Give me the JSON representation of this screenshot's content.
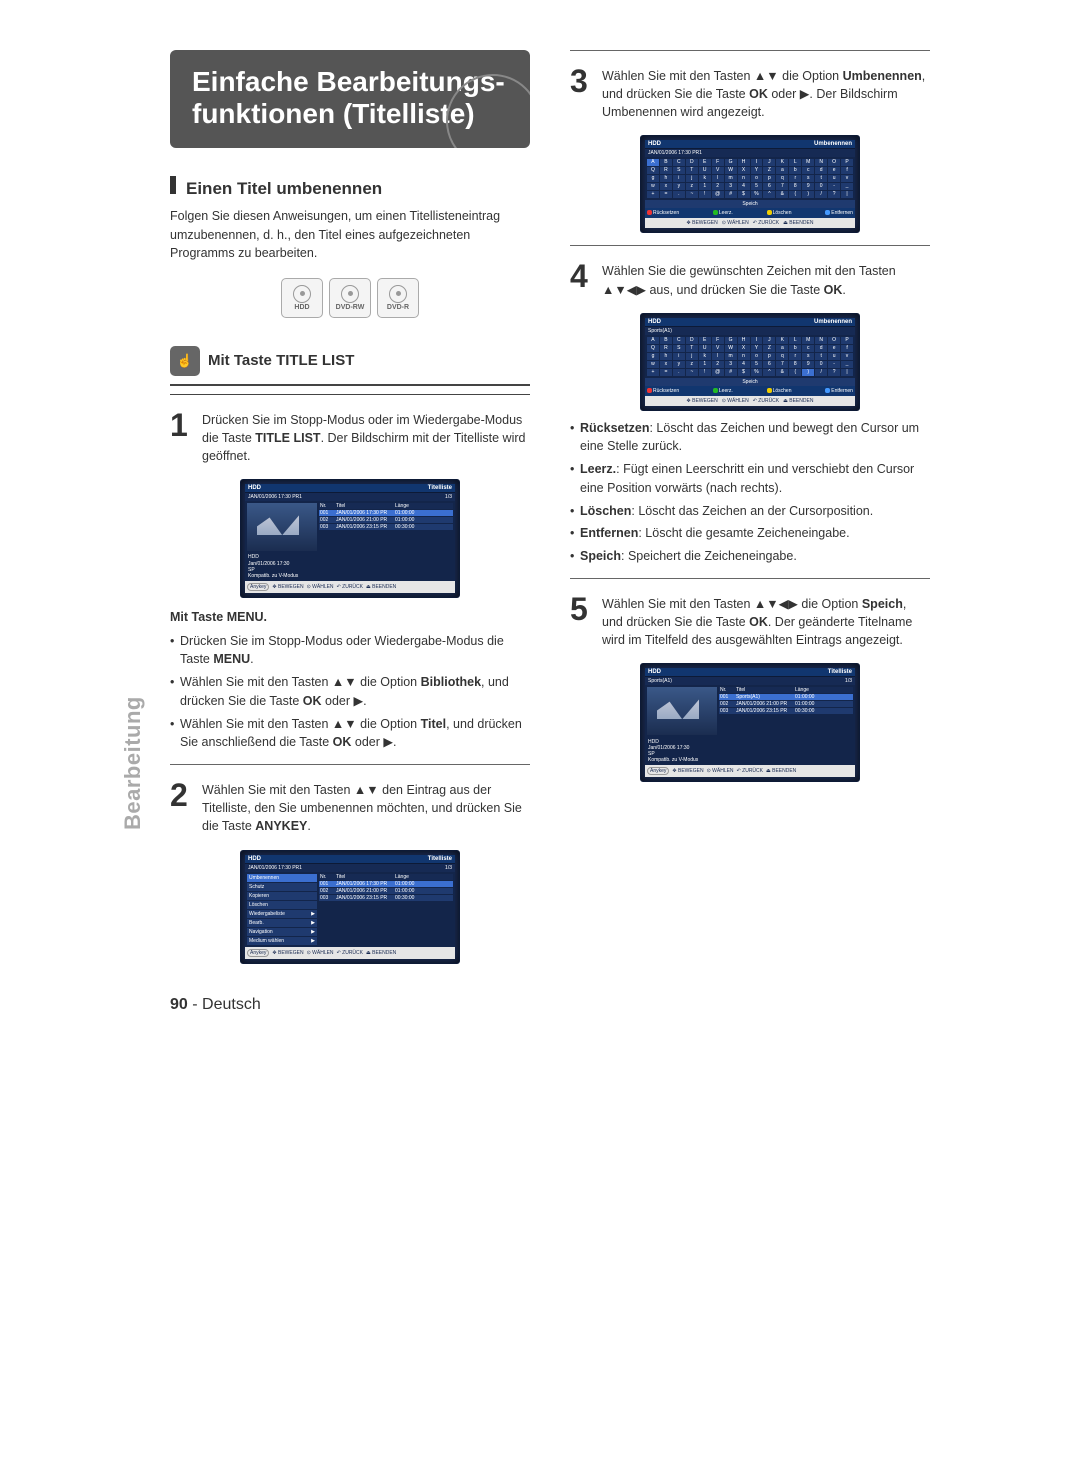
{
  "page": {
    "number": "90",
    "lang": "Deutsch",
    "side_tab": "Bearbeitung"
  },
  "title": "Einfache Bearbeitungs-\nfunktionen (Titelliste)",
  "section_heading": "Einen Titel umbenennen",
  "intro": "Folgen Sie diesen Anweisungen, um einen Titellisteneintrag umzubenennen, d. h., den Titel eines aufgezeichneten Programms zu bearbeiten.",
  "media": [
    "HDD",
    "DVD-RW",
    "DVD-R"
  ],
  "subhead_titlelist": "Mit Taste TITLE LIST",
  "steps": {
    "s1": {
      "num": "1",
      "text": "Drücken Sie im Stopp-Modus oder im Wiedergabe-Modus die Taste ",
      "bold1": "TITLE LIST",
      "text2": ". Der Bildschirm mit der Titelliste wird geöffnet."
    },
    "menu_sub": "Mit Taste MENU.",
    "menu_items": [
      [
        "Drücken Sie im Stopp-Modus oder Wiedergabe-Modus die Taste ",
        "MENU",
        "."
      ],
      [
        "Wählen Sie mit den Tasten ▲▼ die Option ",
        "Bibliothek",
        ", und drücken Sie die Taste ",
        "OK",
        " oder ▶."
      ],
      [
        "Wählen Sie mit den Tasten ▲▼ die Option ",
        "Titel",
        ", und drücken Sie anschließend die Taste ",
        "OK",
        " oder ▶."
      ]
    ],
    "s2": {
      "num": "2",
      "text": "Wählen Sie mit den Tasten ▲▼ den Eintrag aus der Titelliste, den Sie umbenennen möchten, und drücken Sie die Taste ",
      "bold1": "ANYKEY",
      "text2": "."
    },
    "s3": {
      "num": "3",
      "text": "Wählen Sie mit den Tasten ▲▼ die Option ",
      "bold1": "Umbenennen",
      "text2": ", und drücken Sie die Taste ",
      "bold2": "OK",
      "text3": " oder ▶. Der Bildschirm Umbenennen wird angezeigt."
    },
    "s4": {
      "num": "4",
      "text": "Wählen Sie die gewünschten Zeichen mit den Tasten ▲▼◀▶ aus, und drücken Sie die Taste ",
      "bold1": "OK",
      "text2": "."
    },
    "edit_items": [
      [
        "Rücksetzen",
        ": Löscht das Zeichen und bewegt den Cursor um eine Stelle zurück."
      ],
      [
        "Leerz.",
        ": Fügt einen Leerschritt ein und verschiebt den Cursor eine Position vorwärts (nach rechts)."
      ],
      [
        "Löschen",
        ": Löscht das Zeichen an der Cursorposition."
      ],
      [
        "Entfernen",
        ": Löscht die gesamte Zeicheneingabe."
      ],
      [
        "Speich",
        ": Speichert die Zeicheneingabe."
      ]
    ],
    "s5": {
      "num": "5",
      "text": "Wählen Sie mit den Tasten ▲▼◀▶ die Option ",
      "bold1": "Speich",
      "text2": ", und drücken Sie die Taste ",
      "bold2": "OK",
      "text3": ". Der geänderte Titelname wird im Titelfeld des ausgewählten Eintrags angezeigt."
    }
  },
  "tv_common": {
    "hdd": "HDD",
    "footer": {
      "move": "BEWEGEN",
      "sel": "WÄHLEN",
      "back": "ZURÜCK",
      "exit": "BEENDEN"
    },
    "btns": {
      "reset": "Rücksetzen",
      "space": "Leerz.",
      "del": "Löschen",
      "rem": "Entfernen"
    },
    "save": "Speich",
    "anykey": "Anykey"
  },
  "tv1": {
    "title": "Titelliste",
    "sub": "JAN/01/2006 17:30 PR1",
    "page": "1/3",
    "cols": [
      "Nr.",
      "Titel",
      "Länge"
    ],
    "rows": [
      [
        "001",
        "JAN/01/2006 17:30 PR",
        "01:00:00"
      ],
      [
        "002",
        "JAN/01/2006 21:00 PR",
        "01:00:00"
      ],
      [
        "003",
        "JAN/01/2006 23:15 PR",
        "00:30:00"
      ]
    ],
    "meta": [
      "HDD",
      "Jan/01/2006 17:30",
      "SP",
      "Kompatib. zu V-Modus"
    ]
  },
  "tv2": {
    "title": "Titelliste",
    "sub": "JAN/01/2006 17:30 PR1",
    "page": "1/3",
    "cols": [
      "Nr.",
      "Titel",
      "Länge"
    ],
    "rows": [
      [
        "001",
        "JAN/01/2006 17:30 PR",
        "01:00:00"
      ],
      [
        "002",
        "JAN/01/2006 21:00 PR",
        "01:00:00"
      ],
      [
        "003",
        "JAN/01/2006 23:15 PR",
        "00:30:00"
      ]
    ],
    "menu": [
      "Umbenennen",
      "Schutz",
      "Kopieren",
      "Löschen",
      "Wiedergabeliste",
      "Bearb.",
      "Navigation",
      "Medium wählen"
    ]
  },
  "tv3": {
    "title": "Umbenennen",
    "sub": "JAN/01/2006 17:30 PR1",
    "kb": [
      [
        "A",
        "B",
        "C",
        "D",
        "E",
        "F",
        "G",
        "H",
        "I",
        "J",
        "K",
        "L",
        "M",
        "N",
        "O",
        "P"
      ],
      [
        "Q",
        "R",
        "S",
        "T",
        "U",
        "V",
        "W",
        "X",
        "Y",
        "Z",
        "a",
        "b",
        "c",
        "d",
        "e",
        "f"
      ],
      [
        "g",
        "h",
        "i",
        "j",
        "k",
        "l",
        "m",
        "n",
        "o",
        "p",
        "q",
        "r",
        "s",
        "t",
        "u",
        "v"
      ],
      [
        "w",
        "x",
        "y",
        "z",
        "1",
        "2",
        "3",
        "4",
        "5",
        "6",
        "7",
        "8",
        "9",
        "0",
        "-",
        "_"
      ],
      [
        "+",
        "=",
        ".",
        "~",
        "!",
        "@",
        "#",
        "$",
        "%",
        "^",
        "&",
        "(",
        ")",
        "/",
        "?",
        "|"
      ]
    ]
  },
  "tv4": {
    "title": "Umbenennen",
    "sub": "Sports(A1)",
    "kb": [
      [
        "A",
        "B",
        "C",
        "D",
        "E",
        "F",
        "G",
        "H",
        "I",
        "J",
        "K",
        "L",
        "M",
        "N",
        "O",
        "P"
      ],
      [
        "Q",
        "R",
        "S",
        "T",
        "U",
        "V",
        "W",
        "X",
        "Y",
        "Z",
        "a",
        "b",
        "c",
        "d",
        "e",
        "f"
      ],
      [
        "g",
        "h",
        "i",
        "j",
        "k",
        "l",
        "m",
        "n",
        "o",
        "p",
        "q",
        "r",
        "s",
        "t",
        "u",
        "v"
      ],
      [
        "w",
        "x",
        "y",
        "z",
        "1",
        "2",
        "3",
        "4",
        "5",
        "6",
        "7",
        "8",
        "9",
        "0",
        "-",
        "_"
      ],
      [
        "+",
        "=",
        ".",
        "~",
        "!",
        "@",
        "#",
        "$",
        "%",
        "^",
        "&",
        "(",
        ")",
        "/",
        "?",
        "|"
      ]
    ]
  },
  "tv5": {
    "title": "Titelliste",
    "sub": "Sports(A1)",
    "page": "1/3",
    "cols": [
      "Nr.",
      "Titel",
      "Länge"
    ],
    "rows": [
      [
        "001",
        "Sports(A1)",
        "01:00:00"
      ],
      [
        "002",
        "JAN/01/2006 21:00 PR",
        "01:00:00"
      ],
      [
        "003",
        "JAN/01/2006 23:15 PR",
        "00:30:00"
      ]
    ],
    "meta": [
      "HDD",
      "Jan/01/2006 17:30",
      "SP",
      "Kompatib. zu V-Modus"
    ]
  }
}
